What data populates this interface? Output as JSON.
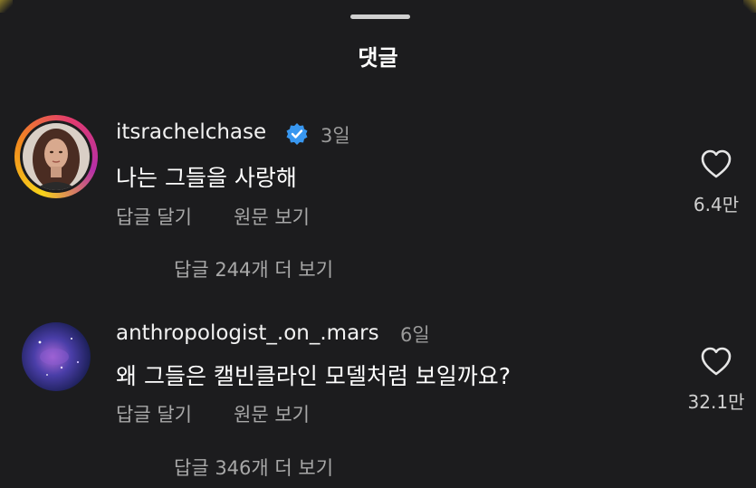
{
  "header": {
    "title": "댓글"
  },
  "comments": [
    {
      "username": "itsrachelchase",
      "verified": true,
      "age": "3일",
      "text": "나는 그들을 사랑해",
      "reply_label": "답글 달기",
      "original_label": "원문 보기",
      "likes": "6.4만",
      "view_replies": "답글 244개 더 보기"
    },
    {
      "username": "anthropologist_.on_.mars",
      "verified": false,
      "age": "6일",
      "text": "왜 그들은 캘빈클라인 모델처럼 보일까요?",
      "reply_label": "답글 달기",
      "original_label": "원문 보기",
      "likes": "32.1만",
      "view_replies": "답글 346개 더 보기"
    }
  ],
  "colors": {
    "background": "#1c1c1e",
    "verified_badge": "#3897f0",
    "muted_text": "#a8a8a8"
  },
  "icons": {
    "verified": "verified-badge-icon",
    "like": "heart-outline-icon"
  }
}
